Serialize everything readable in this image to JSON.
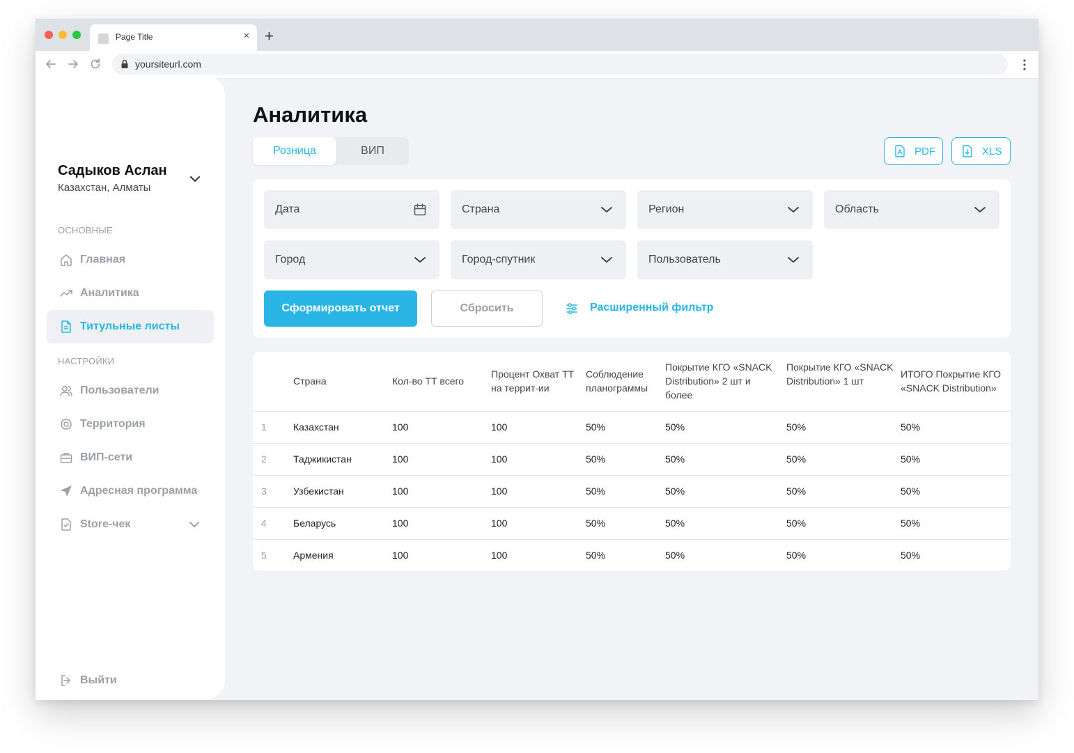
{
  "browser": {
    "tab_title": "Page Title",
    "url": "yoursiteurl.com"
  },
  "user": {
    "name": "Садыков Аслан",
    "location": "Казахстан, Алматы"
  },
  "sidebar": {
    "section_main": "ОСНОВНЫЕ",
    "section_settings": "НАСТРОЙКИ",
    "items": [
      {
        "label": "Главная",
        "icon": "home-icon"
      },
      {
        "label": "Аналитика",
        "icon": "trend-icon"
      },
      {
        "label": "Титульные листы",
        "icon": "document-icon",
        "active": true
      },
      {
        "label": "Пользователи",
        "icon": "users-icon"
      },
      {
        "label": "Территория",
        "icon": "target-icon"
      },
      {
        "label": "ВИП-сети",
        "icon": "briefcase-icon"
      },
      {
        "label": "Адресная программа",
        "icon": "navigation-icon"
      },
      {
        "label": "Store-чек",
        "icon": "checklist-icon"
      }
    ],
    "logout": "Выйти"
  },
  "page": {
    "title": "Аналитика",
    "tabs": [
      "Розница",
      "ВИП"
    ],
    "export_pdf": "PDF",
    "export_xls": "XLS"
  },
  "filters": {
    "date": "Дата",
    "country": "Страна",
    "region": "Регион",
    "oblast": "Область",
    "city": "Город",
    "satellite_city": "Город-спутник",
    "user": "Пользователь",
    "submit": "Сформировать отчет",
    "reset": "Сбросить",
    "advanced": "Расширенный фильтр"
  },
  "table": {
    "headers": [
      "Страна",
      "Кол-во ТТ всего",
      "Процент Охват ТТ на террит-ии",
      "Соблюдение планограммы",
      "Покрытие КГО «SNACK Distribution» 2 шт и более",
      "Покрытие КГО «SNACK Distribution» 1 шт",
      "ИТОГО Покрытие КГО «SNACK Distribution»"
    ],
    "rows": [
      {
        "n": "1",
        "country": "Казахстан",
        "total": "100",
        "coverage": "100",
        "planogram": "50%",
        "kgo2": "50%",
        "kgo1": "50%",
        "kgo_total": "50%"
      },
      {
        "n": "2",
        "country": "Таджикистан",
        "total": "100",
        "coverage": "100",
        "planogram": "50%",
        "kgo2": "50%",
        "kgo1": "50%",
        "kgo_total": "50%"
      },
      {
        "n": "3",
        "country": "Узбекистан",
        "total": "100",
        "coverage": "100",
        "planogram": "50%",
        "kgo2": "50%",
        "kgo1": "50%",
        "kgo_total": "50%"
      },
      {
        "n": "4",
        "country": "Беларусь",
        "total": "100",
        "coverage": "100",
        "planogram": "50%",
        "kgo2": "50%",
        "kgo1": "50%",
        "kgo_total": "50%"
      },
      {
        "n": "5",
        "country": "Армения",
        "total": "100",
        "coverage": "100",
        "planogram": "50%",
        "kgo2": "50%",
        "kgo1": "50%",
        "kgo_total": "50%"
      }
    ]
  },
  "colors": {
    "accent": "#29b6e6",
    "background": "#f2f3f6",
    "muted": "#9aa0a6"
  }
}
